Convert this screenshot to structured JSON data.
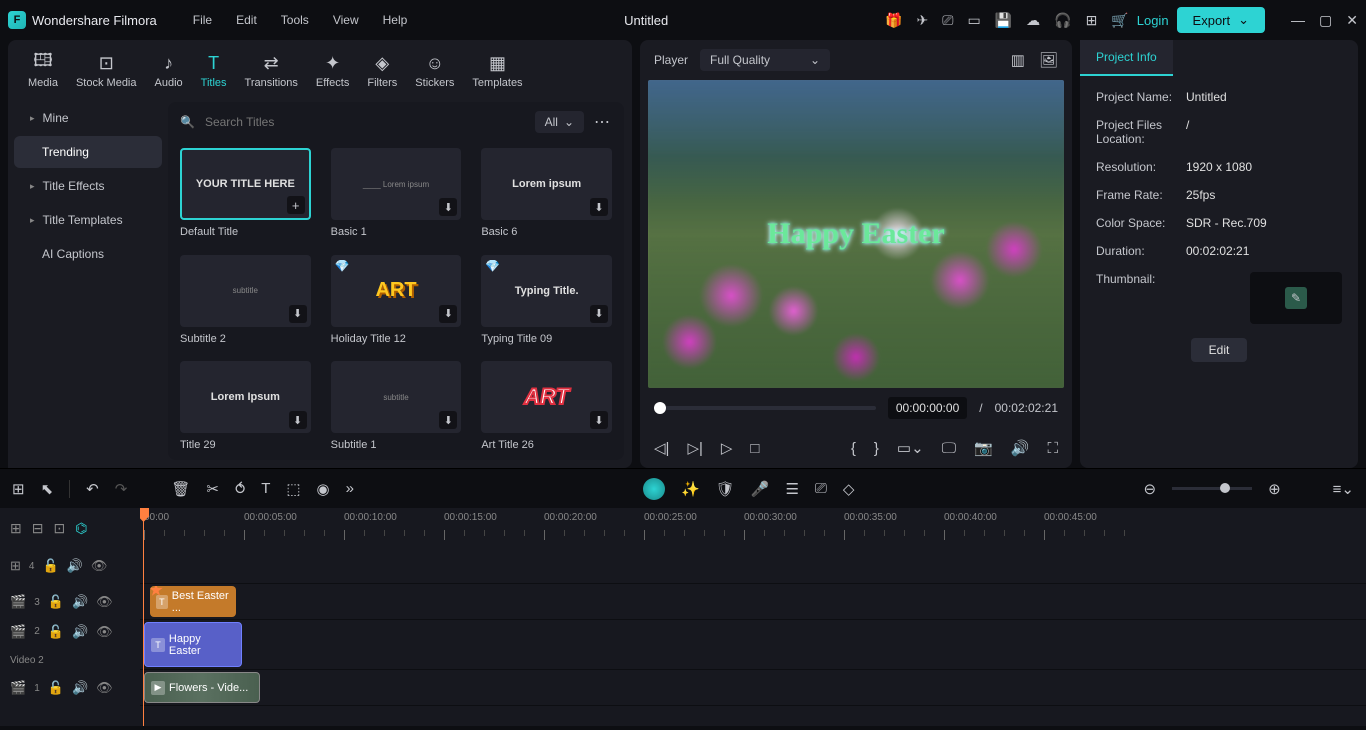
{
  "app": {
    "name": "Wondershare Filmora",
    "doc_title": "Untitled"
  },
  "menubar": [
    "File",
    "Edit",
    "Tools",
    "View",
    "Help"
  ],
  "login": "Login",
  "export": "Export",
  "tabs": [
    {
      "id": "media",
      "label": "Media",
      "icon": "🖽"
    },
    {
      "id": "stock",
      "label": "Stock Media",
      "icon": "⊡"
    },
    {
      "id": "audio",
      "label": "Audio",
      "icon": "♪"
    },
    {
      "id": "titles",
      "label": "Titles",
      "icon": "T",
      "active": true
    },
    {
      "id": "transitions",
      "label": "Transitions",
      "icon": "⇄"
    },
    {
      "id": "effects",
      "label": "Effects",
      "icon": "✦"
    },
    {
      "id": "filters",
      "label": "Filters",
      "icon": "◈"
    },
    {
      "id": "stickers",
      "label": "Stickers",
      "icon": "☺"
    },
    {
      "id": "templates",
      "label": "Templates",
      "icon": "▦"
    }
  ],
  "sidebar": [
    {
      "label": "Mine",
      "sub": false,
      "tri": true
    },
    {
      "label": "Trending",
      "sub": true,
      "active": true
    },
    {
      "label": "Title Effects",
      "sub": false,
      "tri": true
    },
    {
      "label": "Title Templates",
      "sub": false,
      "tri": true
    },
    {
      "label": "AI Captions",
      "sub": true
    }
  ],
  "search": {
    "placeholder": "Search Titles",
    "filter": "All"
  },
  "titles_grid": [
    {
      "label": "Default Title",
      "thumb": "YOUR TITLE HERE",
      "selected": true,
      "add": true
    },
    {
      "label": "Basic 1",
      "thumb": "____",
      "small": "Lorem ipsum",
      "dl": true
    },
    {
      "label": "Basic 6",
      "thumb": "Lorem ipsum",
      "dl": true
    },
    {
      "label": "Subtitle 2",
      "thumb": "",
      "small": "subtitle",
      "dl": true
    },
    {
      "label": "Holiday Title 12",
      "thumb": "ART",
      "art": 1,
      "diamond": true,
      "dl": true
    },
    {
      "label": "Typing Title 09",
      "thumb": "Typing Title.",
      "diamond": true,
      "dl": true
    },
    {
      "label": "Title 29",
      "thumb": "Lorem Ipsum",
      "dl": true
    },
    {
      "label": "Subtitle 1",
      "thumb": "",
      "small": "subtitle",
      "dl": true
    },
    {
      "label": "Art Title 26",
      "thumb": "ART",
      "art": 2,
      "dl": true
    }
  ],
  "preview": {
    "tab": "Player",
    "quality": "Full Quality",
    "overlay_title": "Happy Easter",
    "time_current": "00:00:00:00",
    "time_total": "00:02:02:21"
  },
  "info": {
    "tab": "Project Info",
    "rows": {
      "name_label": "Project Name:",
      "name": "Untitled",
      "loc_label": "Project Files Location:",
      "loc": "/",
      "res_label": "Resolution:",
      "res": "1920 x 1080",
      "fr_label": "Frame Rate:",
      "fr": "25fps",
      "cs_label": "Color Space:",
      "cs": "SDR - Rec.709",
      "dur_label": "Duration:",
      "dur": "00:02:02:21",
      "thumb_label": "Thumbnail:"
    },
    "edit": "Edit"
  },
  "timeline": {
    "ruler": [
      "00:00",
      "00:00:05:00",
      "00:00:10:00",
      "00:00:15:00",
      "00:00:20:00",
      "00:00:25:00",
      "00:00:30:00",
      "00:00:35:00",
      "00:00:40:00",
      "00:00:45:00"
    ],
    "track3_label": "3",
    "track2_num": "2",
    "track2_label": "Video 2",
    "track1_label": "1",
    "clip_easter": "Best Easter ...",
    "clip_happy": "Happy Easter",
    "clip_flowers": "Flowers - Vide..."
  }
}
